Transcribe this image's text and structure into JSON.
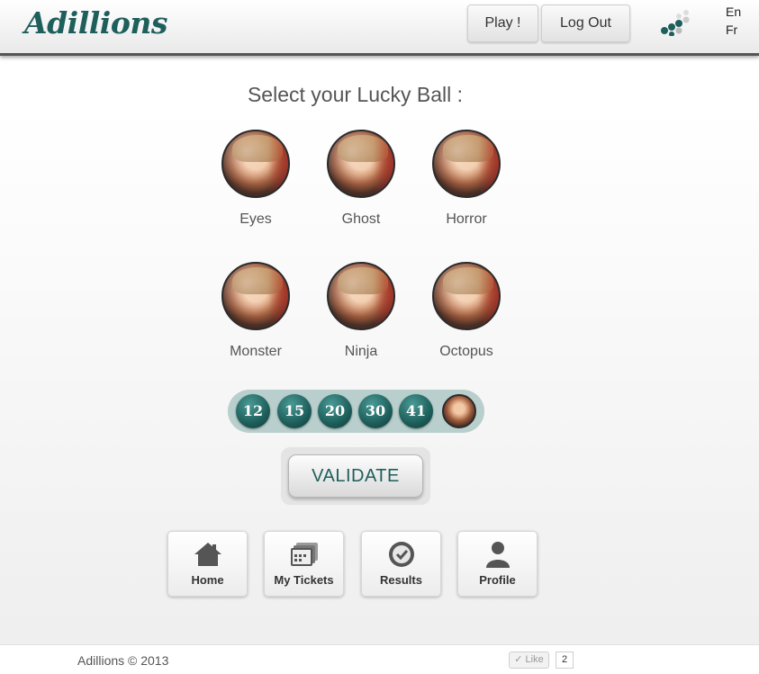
{
  "header": {
    "logo": "Adillions",
    "play_label": "Play !",
    "logout_label": "Log Out",
    "languages": [
      "En",
      "Fr"
    ]
  },
  "main": {
    "title": "Select your Lucky Ball :",
    "balls": [
      {
        "label": "Eyes"
      },
      {
        "label": "Ghost"
      },
      {
        "label": "Horror"
      },
      {
        "label": "Monster"
      },
      {
        "label": "Ninja"
      },
      {
        "label": "Octopus"
      }
    ],
    "selected_numbers": [
      "12",
      "15",
      "20",
      "30",
      "41"
    ],
    "validate_label": "VALIDATE"
  },
  "nav": [
    {
      "label": "Home",
      "icon": "home-icon"
    },
    {
      "label": "My Tickets",
      "icon": "tickets-icon"
    },
    {
      "label": "Results",
      "icon": "results-icon"
    },
    {
      "label": "Profile",
      "icon": "profile-icon"
    }
  ],
  "footer": {
    "copyright": "Adillions © 2013",
    "like_label": "Like",
    "like_count": "2"
  },
  "colors": {
    "brand": "#1e5f5c",
    "pill_bg": "#b9cfcd"
  }
}
